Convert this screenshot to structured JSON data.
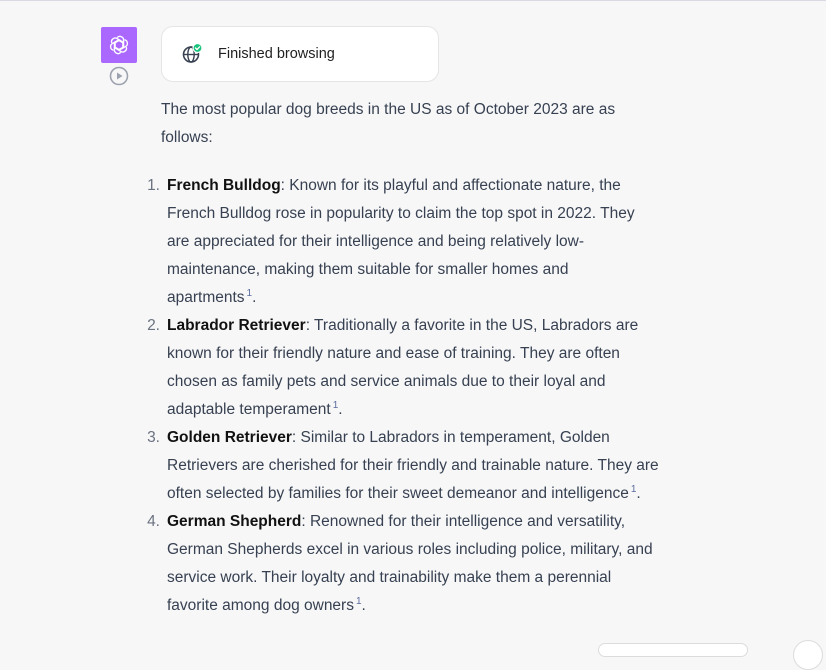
{
  "assistant": {
    "avatar_icon": "openai-logo-icon",
    "avatar_color": "#ab68ff",
    "play_icon": "play-circle-icon"
  },
  "browse_card": {
    "icon": "globe-check-icon",
    "label": "Finished browsing",
    "check_color": "#19c37d"
  },
  "message": {
    "intro": "The most popular dog breeds in the US as of October 2023 are as follows:",
    "items": [
      {
        "number": "1.",
        "name": "French Bulldog",
        "text": ": Known for its playful and affectionate nature, the French Bulldog rose in popularity to claim the top spot in 2022. They are appreciated for their intelligence and being relatively low-maintenance, making them suitable for smaller homes and apartments",
        "cite": "1",
        "end": "."
      },
      {
        "number": "2.",
        "name": "Labrador Retriever",
        "text": ": Traditionally a favorite in the US, Labradors are known for their friendly nature and ease of training. They are often chosen as family pets and service animals due to their loyal and adaptable temperament",
        "cite": "1",
        "end": "."
      },
      {
        "number": "3.",
        "name": "Golden Retriever",
        "text": ": Similar to Labradors in temperament, Golden Retrievers are cherished for their friendly and trainable nature. They are often selected by families for their sweet demeanor and intelligence",
        "cite": "1",
        "end": "."
      },
      {
        "number": "4.",
        "name": "German Shepherd",
        "text": ": Renowned for their intelligence and versatility, German Shepherds excel in various roles including police, military, and service work. Their loyalty and trainability make them a perennial favorite among dog owners",
        "cite": "1",
        "end": "."
      }
    ]
  }
}
